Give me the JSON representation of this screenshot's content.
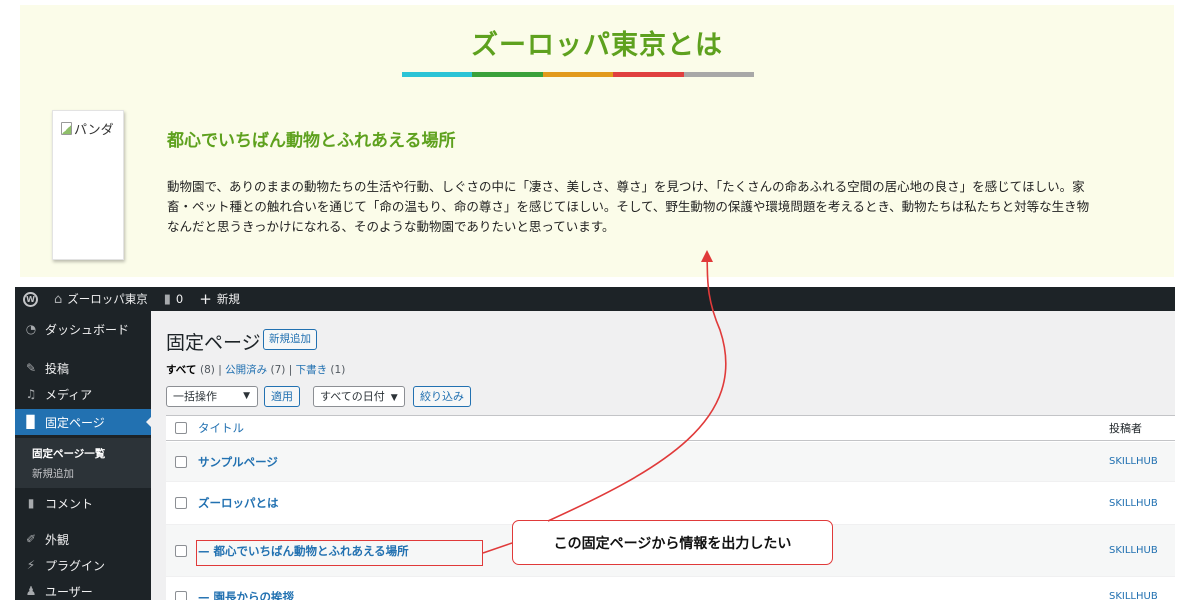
{
  "preview": {
    "title": "ズーロッパ東京とは",
    "title_bar_colors": [
      "#2bc4d6",
      "#3aa13a",
      "#e29a1c",
      "#e04040",
      "#a8a8a8"
    ],
    "image_alt": "パンダ",
    "heading": "都心でいちばん動物とふれあえる場所",
    "body": "動物園で、ありのままの動物たちの生活や行動、しぐさの中に「凄さ、美しさ、尊さ」を見つけ、「たくさんの命あふれる空間の居心地の良さ」を感じてほしい。家畜・ペット種との触れ合いを通じて「命の温もり、命の尊さ」を感じてほしい。そして、野生動物の保護や環境問題を考えるとき、動物たちは私たちと対等な生き物なんだと思うきっかけになれる、そのような動物園でありたいと思っています。"
  },
  "admin_bar": {
    "site_name": "ズーロッパ東京",
    "comments_count": "0",
    "new_label": "新規"
  },
  "sidebar": {
    "items": [
      {
        "label": "ダッシュボード",
        "icon": "dashboard-icon"
      },
      {
        "label": "投稿",
        "icon": "pin-icon"
      },
      {
        "label": "メディア",
        "icon": "media-icon"
      },
      {
        "label": "固定ページ",
        "icon": "page-icon"
      },
      {
        "label": "コメント",
        "icon": "comment-icon"
      },
      {
        "label": "外観",
        "icon": "brush-icon"
      },
      {
        "label": "プラグイン",
        "icon": "plugin-icon"
      },
      {
        "label": "ユーザー",
        "icon": "user-icon"
      }
    ],
    "submenu": [
      "固定ページ一覧",
      "新規追加"
    ]
  },
  "main": {
    "page_title": "固定ページ",
    "add_new": "新規追加",
    "filters": {
      "all": "すべて",
      "all_count": "(8)",
      "published": "公開済み",
      "published_count": "(7)",
      "draft": "下書き",
      "draft_count": "(1)"
    },
    "bulk_action": "一括操作",
    "apply": "適用",
    "all_dates": "すべての日付",
    "filter_button": "絞り込み",
    "columns": {
      "title": "タイトル",
      "author": "投稿者"
    },
    "rows": [
      {
        "title": "サンプルページ",
        "author": "SKILLHUB"
      },
      {
        "title": "ズーロッパとは",
        "author": "SKILLHUB"
      },
      {
        "title": "— 都心でいちばん動物とふれあえる場所",
        "author": "SKILLHUB"
      },
      {
        "title": "— 園長からの挨拶",
        "author": "SKILLHUB"
      }
    ]
  },
  "annotation": {
    "callout": "この固定ページから情報を出力したい",
    "color": "#e03a3a"
  }
}
